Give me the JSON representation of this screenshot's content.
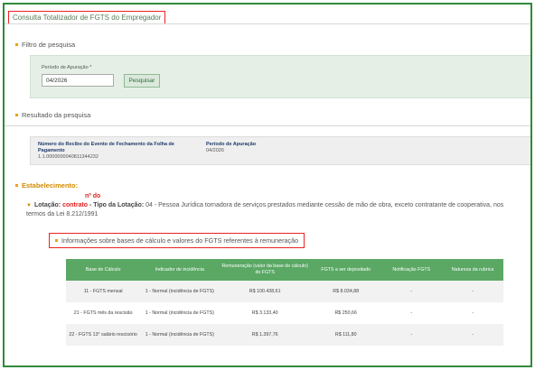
{
  "page": {
    "title": "Consulta Totalizador de FGTS do Empregador"
  },
  "filter": {
    "section_label": "Filtro de pesquisa",
    "period_label": "Período de Apuração *",
    "period_value": "04/2026",
    "search_button": "Pesquisar"
  },
  "result": {
    "section_label": "Resultado da pesquisa",
    "receipt_label": "Número do Recibo do Evento de Fechamento da Folha de Pagamento",
    "receipt_value": "1.1.0000000040811344232",
    "period_label": "Período de Apuração",
    "period_value": "04/2026"
  },
  "establishment": {
    "label": "Estabelecimento:",
    "n_do": "nº do",
    "lotacao_label": "Lotação:",
    "contrato": "contrato",
    "tipo_label": " - Tipo da Lotação:",
    "tipo_value": " 04 - Pessoa Jurídica tornadora de serviços prestados mediante cessão de mão de obra, exceto contratante de cooperativa, nos termos da Lei 8.212/1991"
  },
  "fgts_info": {
    "title": "Informações sobre bases de cálculo e valores do FGTS referentes à remuneração",
    "headers": [
      "Base de Cálculo",
      "Indicador de incidência",
      "Remuneração (valor da base de cálculo) do FGTS",
      "FGTS a ser depositado",
      "Notificação FGTS",
      "Natureza da rubrica"
    ],
    "rows": [
      [
        "11 - FGTS mensal",
        "1 - Normal (incidência de FGTS)",
        "R$ 100.438,61",
        "R$ 8.034,88",
        "-",
        "-"
      ],
      [
        "21 - FGTS mês da rescisão",
        "1 - Normal (incidência de FGTS)",
        "R$ 3.133,40",
        "R$ 250,66",
        "-",
        "-"
      ],
      [
        "22 - FGTS 13° salário rescisório",
        "1 - Normal (incidência de FGTS)",
        "R$ 1.397,76",
        "R$ 111,80",
        "-",
        "-"
      ]
    ]
  },
  "colors": {
    "accent_green": "#5aa864",
    "frame_green": "#2f8a3a",
    "highlight_red": "#e22222",
    "bullet_orange": "#e8a317"
  }
}
